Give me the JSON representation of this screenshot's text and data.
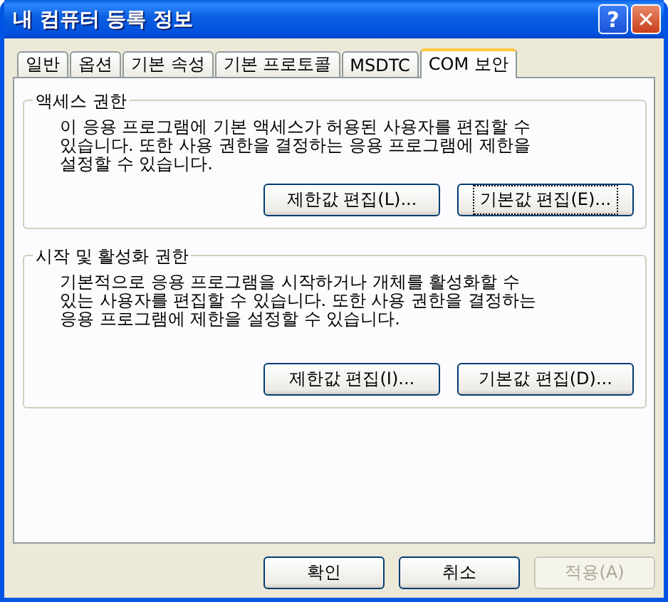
{
  "window": {
    "title": "내 컴퓨터 등록 정보",
    "help_button": "?",
    "close_button": "✕"
  },
  "tabs": [
    {
      "label": "일반",
      "selected": false
    },
    {
      "label": "옵션",
      "selected": false
    },
    {
      "label": "기본 속성",
      "selected": false
    },
    {
      "label": "기본 프로토콜",
      "selected": false
    },
    {
      "label": "MSDTC",
      "selected": false
    },
    {
      "label": "COM 보안",
      "selected": true
    }
  ],
  "groups": [
    {
      "title": "액세스 권한",
      "description": [
        "이 응용 프로그램에 기본 액세스가 허용된 사용자를 편집할 수",
        "있습니다. 또한 사용 권한을 결정하는 응용 프로그램에 제한을",
        "설정할 수 있습니다."
      ],
      "buttons": [
        {
          "label": "제한값 편집(L)...",
          "focused": false
        },
        {
          "label": "기본값 편집(E)...",
          "focused": true
        }
      ]
    },
    {
      "title": "시작 및 활성화 권한",
      "description": [
        "기본적으로 응용 프로그램을 시작하거나 개체를 활성화할 수",
        "있는 사용자를 편집할 수 있습니다. 또한 사용 권한을 결정하는",
        "응용 프로그램에 제한을 설정할 수 있습니다."
      ],
      "buttons": [
        {
          "label": "제한값 편집(I)...",
          "focused": false
        },
        {
          "label": "기본값 편집(D)...",
          "focused": false
        }
      ]
    }
  ],
  "buttons": [
    {
      "label": "확인",
      "disabled": false
    },
    {
      "label": "취소",
      "disabled": false
    },
    {
      "label": "적용(A)",
      "disabled": true
    }
  ]
}
